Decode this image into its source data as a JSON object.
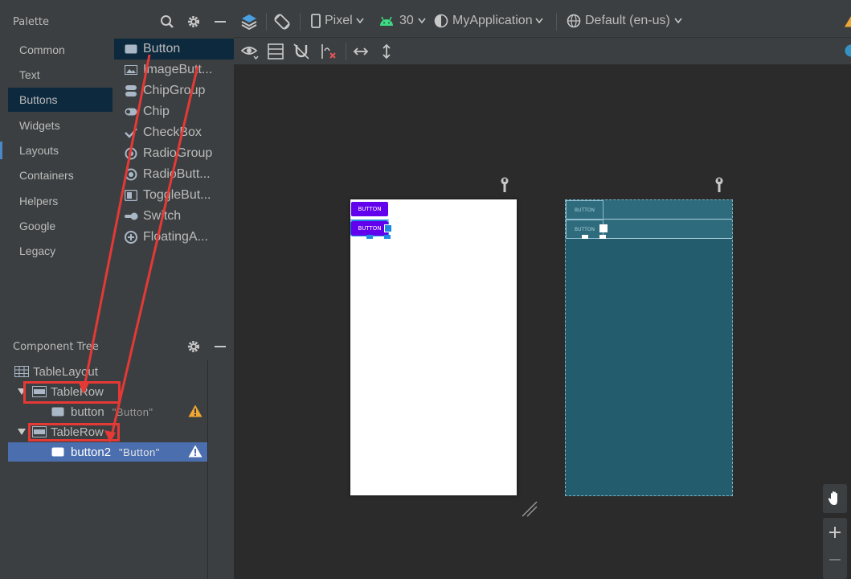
{
  "palette": {
    "title": "Palette",
    "categories": [
      "Common",
      "Text",
      "Buttons",
      "Widgets",
      "Layouts",
      "Containers",
      "Helpers",
      "Google",
      "Legacy"
    ],
    "selected_category": "Buttons",
    "items": [
      "Button",
      "ImageButt...",
      "ChipGroup",
      "Chip",
      "CheckBox",
      "RadioGroup",
      "RadioButt...",
      "ToggleBut...",
      "Switch",
      "FloatingA..."
    ],
    "selected_item": "Button"
  },
  "tree": {
    "title": "Component Tree",
    "nodes": [
      {
        "label": "TableLayout",
        "sub": ""
      },
      {
        "label": "TableRow",
        "sub": ""
      },
      {
        "label": "button",
        "sub": "\"Button\""
      },
      {
        "label": "TableRow",
        "sub": ""
      },
      {
        "label": "button2",
        "sub": "\"Button\""
      }
    ]
  },
  "toolbar": {
    "device": "Pixel",
    "api": "30",
    "theme": "MyApplication",
    "locale": "Default (en-us)"
  },
  "preview": {
    "button_label": "BUTTON"
  },
  "colors": {
    "accent": "#6200ee",
    "selection": "#4b6eaf",
    "highlight": "#e53935",
    "blueprint": "#235c6c"
  }
}
